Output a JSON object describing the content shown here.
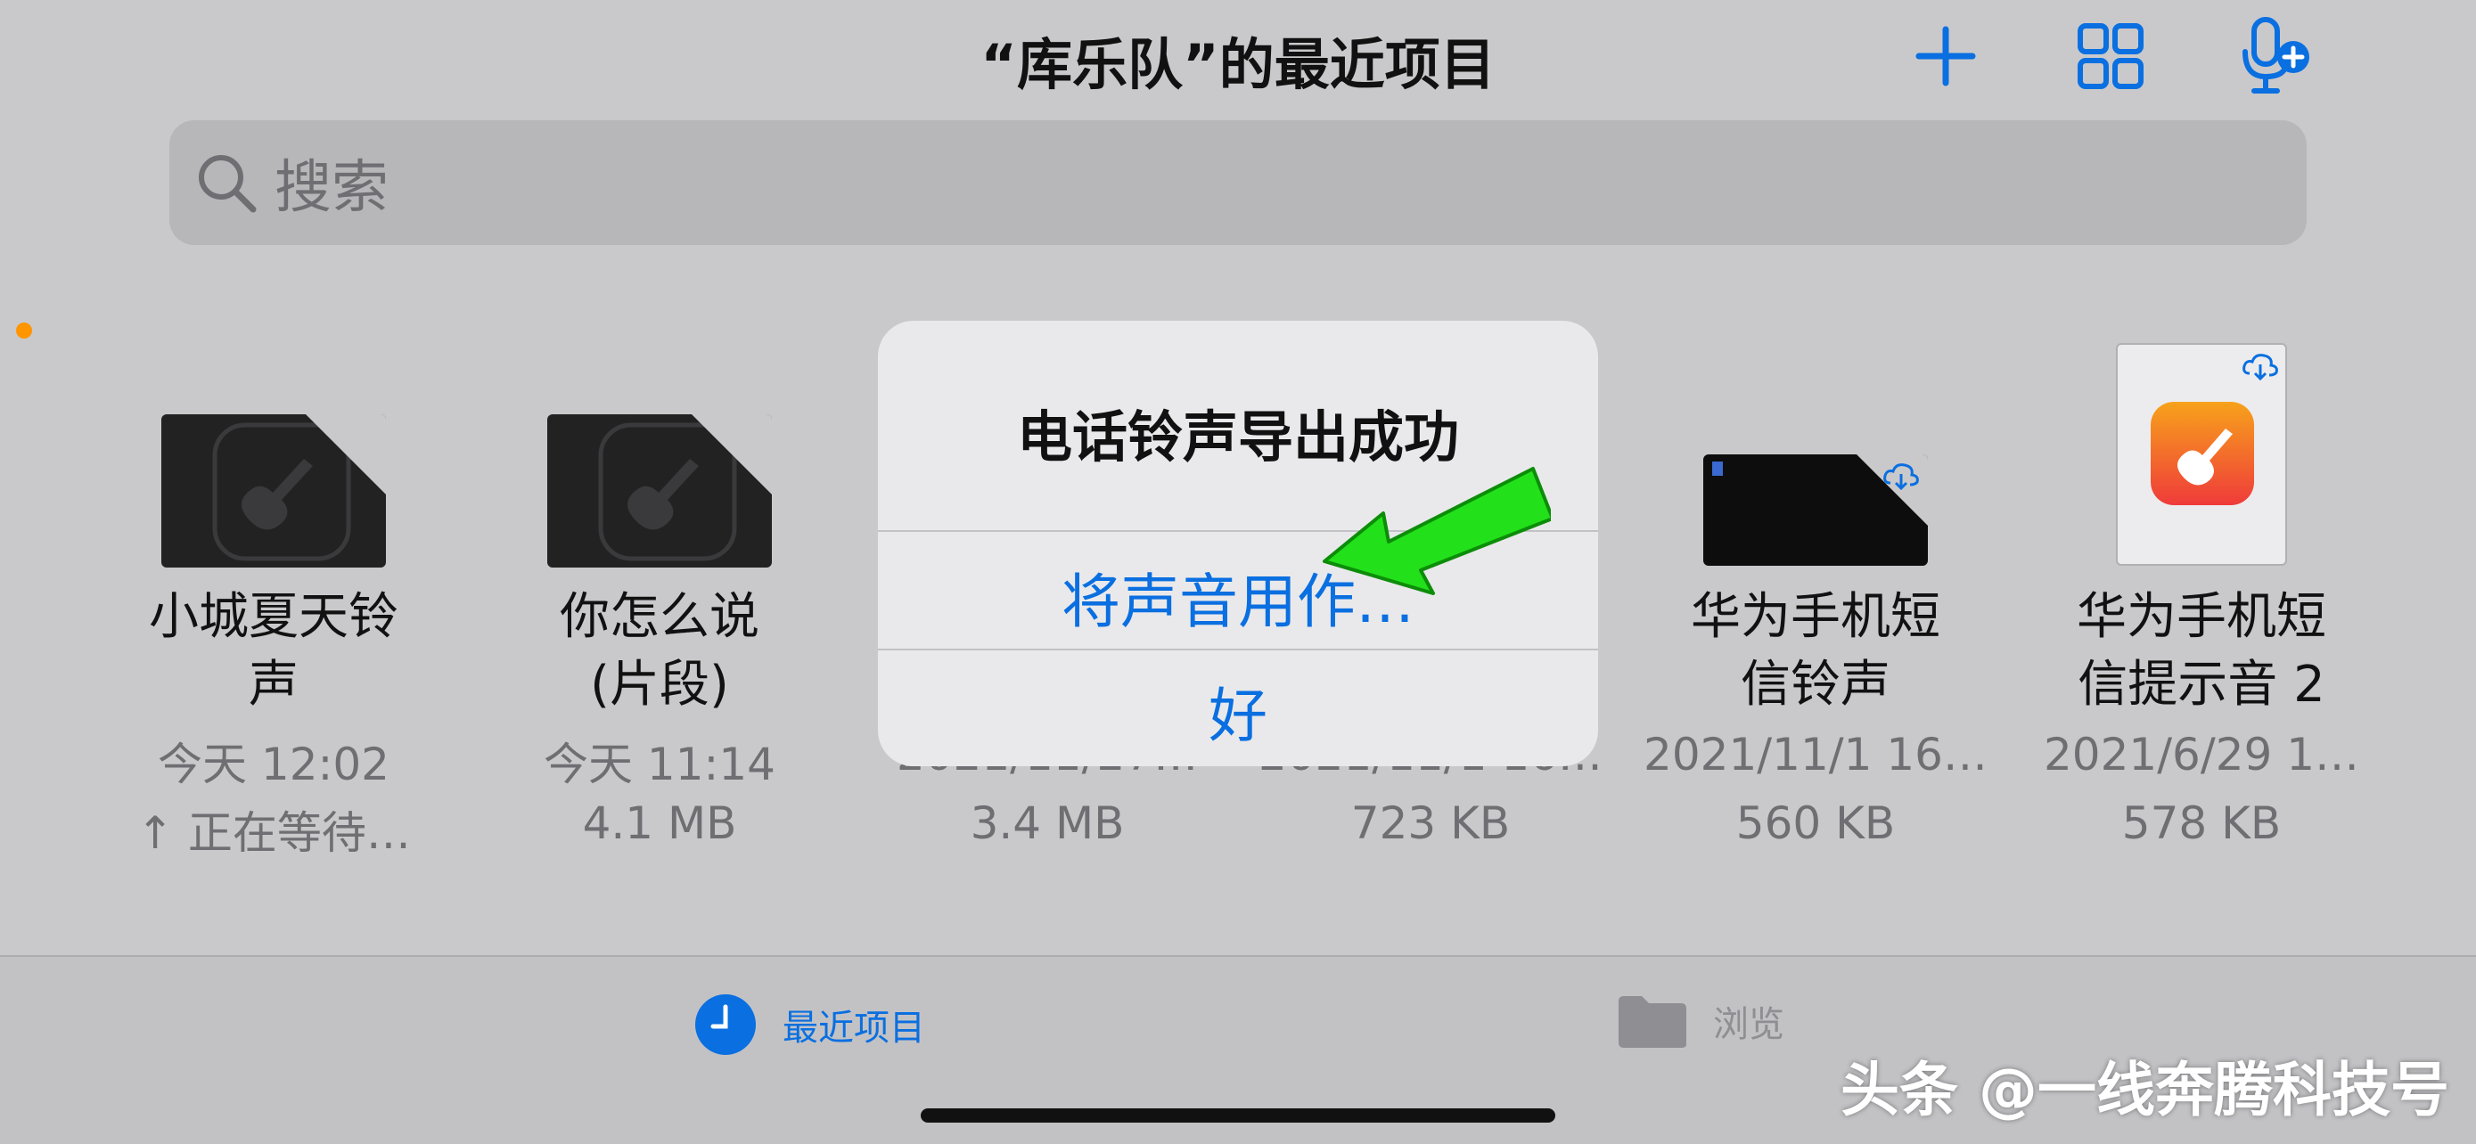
{
  "header": {
    "title": "“库乐队”的最近项目",
    "actions": [
      "plus-icon",
      "grid-view-icon",
      "add-recording-icon"
    ]
  },
  "search": {
    "placeholder": "搜索"
  },
  "files": [
    {
      "name_line1": "小城夏天铃",
      "name_line2": "声",
      "date": "今天 12:02",
      "info": "↑ 正在等待…",
      "thumb": "garageband-dark"
    },
    {
      "name_line1": "你怎么说",
      "name_line2": "(片段)",
      "date": "今天 11:14",
      "info": "4.1 MB",
      "thumb": "garageband-dark"
    },
    {
      "name_line1": "",
      "name_line2": "",
      "date": "2021/11/27…",
      "info": "3.4 MB",
      "thumb": ""
    },
    {
      "name_line1": "",
      "name_line2": "",
      "date": "2021/11/1 16…",
      "info": "723 KB",
      "thumb": ""
    },
    {
      "name_line1": "华为手机短",
      "name_line2": "信铃声",
      "date": "2021/11/1 16…",
      "info": "560 KB",
      "thumb": "dark-cloud"
    },
    {
      "name_line1": "华为手机短",
      "name_line2": "信提示音 2",
      "date": "2021/6/29 1…",
      "info": "578 KB",
      "thumb": "garageband-color"
    }
  ],
  "dialog": {
    "title": "电话铃声导出成功",
    "action_use": "将声音用作…",
    "action_ok": "好"
  },
  "tabbar": {
    "recent": "最近项目",
    "browse": "浏览"
  },
  "watermark": "头条 @一线奔腾科技号",
  "colors": {
    "accent": "#0a6fe0",
    "arrow": "#22e01a",
    "dot": "#ff9500"
  }
}
